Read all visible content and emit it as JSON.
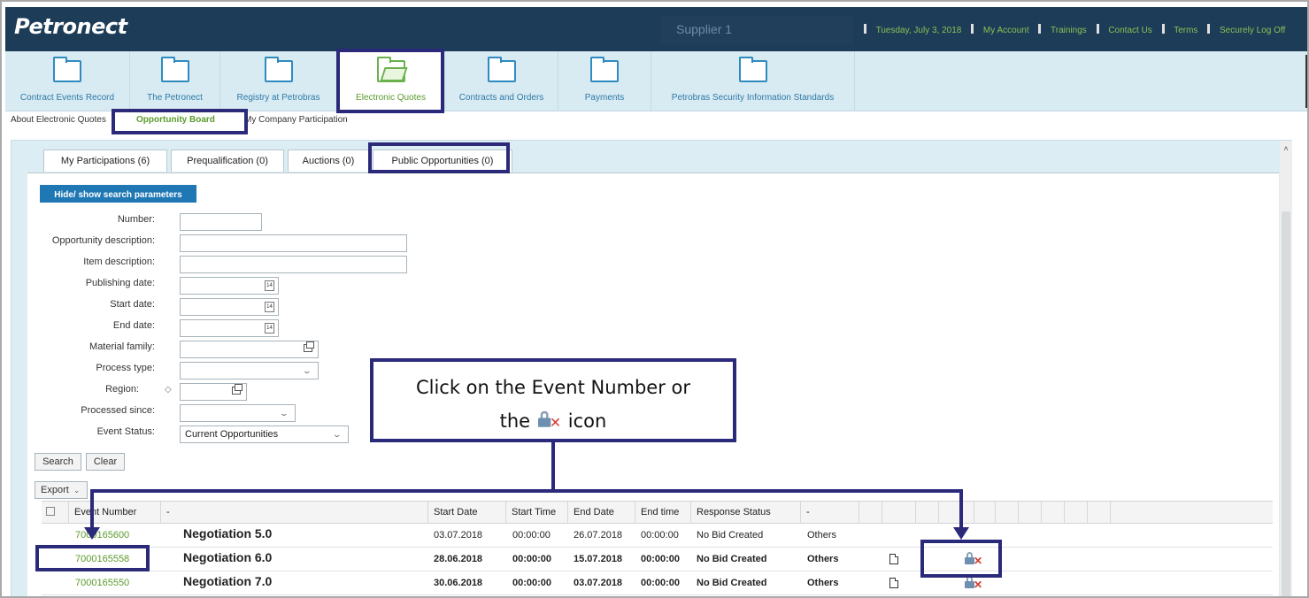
{
  "header": {
    "logo": "Petronect",
    "supplier": "Supplier 1",
    "date": "Tuesday, July 3, 2018",
    "links": [
      "My Account",
      "Trainings",
      "Contact Us",
      "Terms",
      "Securely Log Off"
    ]
  },
  "nav": {
    "items": [
      {
        "label": "Contract Events Record"
      },
      {
        "label": "The Petronect"
      },
      {
        "label": "Registry at Petrobras"
      },
      {
        "label": "Electronic Quotes"
      },
      {
        "label": "Contracts and Orders"
      },
      {
        "label": "Payments"
      },
      {
        "label": "Petrobras Security Information Standards"
      }
    ]
  },
  "subnav": {
    "about": "About Electronic Quotes",
    "opportunity_board": "Opportunity Board",
    "my_company": "My Company Participation"
  },
  "tabs": [
    {
      "label": "My Participations (6)"
    },
    {
      "label": "Prequalification (0)"
    },
    {
      "label": "Auctions (0)"
    },
    {
      "label": "Public Opportunities (0)"
    }
  ],
  "search": {
    "toggle_label": "Hide/ show search parameters",
    "labels": {
      "number": "Number:",
      "opportunity_description": "Opportunity description:",
      "item_description": "Item description:",
      "publishing_date": "Publishing date:",
      "start_date": "Start date:",
      "end_date": "End date:",
      "material_family": "Material family:",
      "process_type": "Process type:",
      "region": "Region:",
      "processed_since": "Processed since:",
      "event_status": "Event Status:"
    },
    "event_status_value": "Current Opportunities",
    "calendar_glyph": "14",
    "search_button": "Search",
    "clear_button": "Clear",
    "export_button": "Export"
  },
  "table": {
    "columns": [
      "Event Number",
      "-",
      "Start Date",
      "Start Time",
      "End Date",
      "End time",
      "Response Status",
      "-"
    ],
    "rows": [
      {
        "event_number": "7000165600",
        "description": "Negotiation 5.0",
        "start_date": "03.07.2018",
        "start_time": "00:00:00",
        "end_date": "26.07.2018",
        "end_time": "00:00:00",
        "status": "No Bid Created",
        "category": "Others"
      },
      {
        "event_number": "7000165558",
        "description": "Negotiation 6.0",
        "start_date": "28.06.2018",
        "start_time": "00:00:00",
        "end_date": "15.07.2018",
        "end_time": "00:00:00",
        "status": "No Bid Created",
        "category": "Others"
      },
      {
        "event_number": "7000165550",
        "description": "Negotiation 7.0",
        "start_date": "30.06.2018",
        "start_time": "00:00:00",
        "end_date": "03.07.2018",
        "end_time": "00:00:00",
        "status": "No Bid Created",
        "category": "Others"
      }
    ]
  },
  "callout": {
    "line1": "Click on the Event Number or",
    "line2_a": "the",
    "line2_b": "icon"
  },
  "colors": {
    "header_bg": "#1c3c57",
    "nav_bg": "#d8eaf2",
    "link_green": "#5a9b2c",
    "annotation": "#2b2a7a",
    "button_blue": "#1f78b4"
  },
  "icons": [
    "folder-icon",
    "calendar-icon",
    "value-help-icon",
    "chevron-down-icon",
    "document-icon",
    "lock-x-icon",
    "select-all-icon"
  ]
}
